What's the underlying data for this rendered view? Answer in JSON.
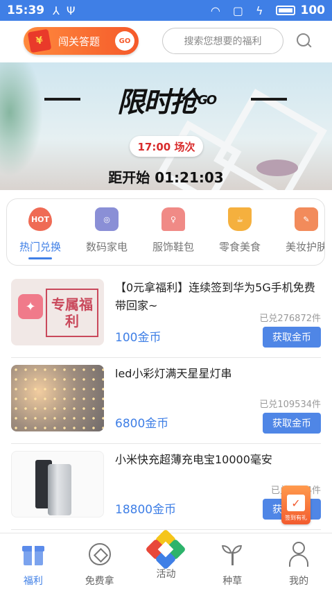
{
  "status_bar": {
    "time": "15:39",
    "battery": "100"
  },
  "header": {
    "quiz_label": "闯关答题",
    "quiz_go": "GO",
    "search_placeholder": "搜索您想要的福利"
  },
  "banner": {
    "title": "限时抢",
    "title_go": "GO",
    "session": "17:00 场次",
    "countdown": "距开始 01:21:03"
  },
  "categories": [
    {
      "label": "热门兑换",
      "icon": "hot-icon",
      "color": "#ef6b55",
      "badge": "HOT"
    },
    {
      "label": "数码家电",
      "icon": "washing-machine-icon",
      "color": "#8a8fd6"
    },
    {
      "label": "服饰鞋包",
      "icon": "dress-icon",
      "color": "#f08a86"
    },
    {
      "label": "零食美食",
      "icon": "coffee-icon",
      "color": "#f5b03e"
    },
    {
      "label": "美妆护肤",
      "icon": "makeup-icon",
      "color": "#f28b5b"
    }
  ],
  "products": [
    {
      "title": "【0元拿福利】连续签到华为5G手机免费带回家~",
      "sold": "已兑276872件",
      "price": "100金币",
      "button": "获取金币",
      "image_text": "专属福利"
    },
    {
      "title": "led小彩灯满天星星灯串",
      "sold": "已兑109534件",
      "price": "6800金币",
      "button": "获取金币"
    },
    {
      "title": "小米快充超薄充电宝10000毫安",
      "sold": "已兑1494件",
      "price": "18800金币",
      "button": "获取金币"
    }
  ],
  "float_sign": {
    "label": "签到有礼"
  },
  "bottom_nav": [
    {
      "label": "福利",
      "icon": "gift-icon",
      "active": true
    },
    {
      "label": "免费拿",
      "icon": "coin-icon"
    },
    {
      "label": "活动",
      "icon": "activity-icon"
    },
    {
      "label": "种草",
      "icon": "sprout-icon"
    },
    {
      "label": "我的",
      "icon": "user-icon"
    }
  ],
  "colors": {
    "accent": "#3f7fe6",
    "button": "#4f86e6",
    "orange": "#f5592a"
  }
}
